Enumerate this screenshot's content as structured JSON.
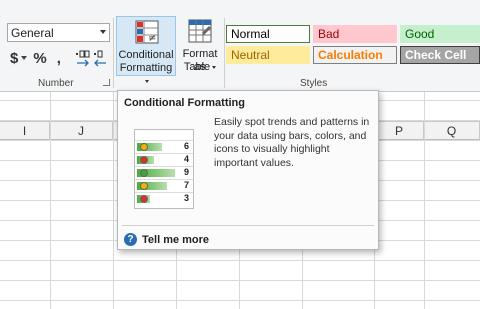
{
  "number_group": {
    "format_value": "General",
    "currency_symbol": "$",
    "percent_symbol": "%",
    "comma_symbol": ",",
    "label": "Number"
  },
  "conditional_formatting": {
    "line1": "Conditional",
    "line2": "Formatting",
    "icon": "conditional-formatting-icon"
  },
  "format_as_table": {
    "line1": "Format as",
    "line2": "Table",
    "icon": "format-table-icon"
  },
  "styles": {
    "label": "Styles",
    "cells": [
      {
        "label": "Normal",
        "bg": "#ffffff",
        "fg": "#000000",
        "border": "#4a7c3a"
      },
      {
        "label": "Bad",
        "bg": "#ffc7ce",
        "fg": "#9c0006",
        "border": "#ffc7ce"
      },
      {
        "label": "Good",
        "bg": "#c6efce",
        "fg": "#006100",
        "border": "#c6efce"
      },
      {
        "label": "Neutral",
        "bg": "#ffeb9c",
        "fg": "#9c6500",
        "border": "#ffeb9c"
      },
      {
        "label": "Calculation",
        "bg": "#f2f2f2",
        "fg": "#fa7d00",
        "border": "#7f7f7f"
      },
      {
        "label": "Check Cell",
        "bg": "#a5a5a5",
        "fg": "#ffffff",
        "border": "#3f3f3f"
      }
    ]
  },
  "columns": [
    "I",
    "J",
    "P",
    "Q"
  ],
  "tooltip": {
    "title": "Conditional Formatting",
    "description": "Easily spot trends and patterns in your data using bars, colors, and icons to visually highlight important values.",
    "sample_values": [
      6,
      4,
      9,
      7,
      3
    ],
    "sample_icons": [
      "neutral-icon",
      "negative-icon",
      "positive-icon",
      "neutral-icon",
      "negative-icon"
    ],
    "icon_colors": {
      "neutral-icon": "#f0b400",
      "negative-icon": "#d9312b",
      "positive-icon": "#3fa43a"
    },
    "help_icon": "help-icon",
    "help_link": "Tell me more"
  }
}
